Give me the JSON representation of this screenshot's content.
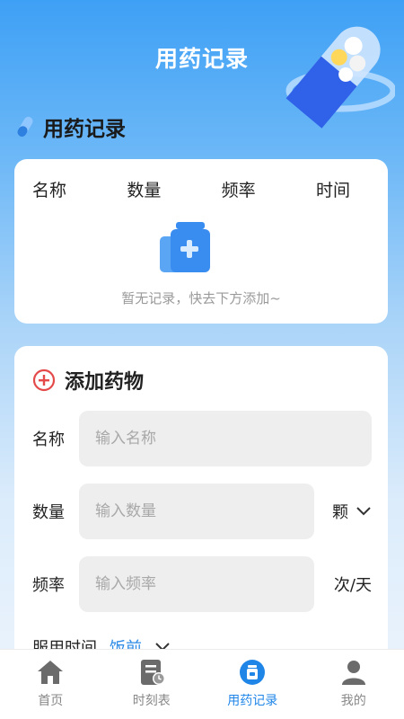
{
  "header": {
    "title": "用药记录"
  },
  "records": {
    "section_title": "用药记录",
    "columns": [
      "名称",
      "数量",
      "频率",
      "时间"
    ],
    "empty_text": "暂无记录，快去下方添加~"
  },
  "add_form": {
    "title": "添加药物",
    "name": {
      "label": "名称",
      "placeholder": "输入名称"
    },
    "quantity": {
      "label": "数量",
      "placeholder": "输入数量",
      "unit": "颗"
    },
    "frequency": {
      "label": "频率",
      "placeholder": "输入频率",
      "unit": "次/天"
    },
    "time": {
      "label": "服用时间",
      "value": "饭前"
    }
  },
  "tabbar": {
    "items": [
      {
        "label": "首页",
        "icon": "home-icon"
      },
      {
        "label": "时刻表",
        "icon": "schedule-icon"
      },
      {
        "label": "用药记录",
        "icon": "medicine-record-icon",
        "active": true
      },
      {
        "label": "我的",
        "icon": "user-icon"
      }
    ]
  },
  "colors": {
    "accent": "#1f86e8",
    "add_icon": "#e44a4a",
    "header_bg": "#3ea0f5"
  }
}
